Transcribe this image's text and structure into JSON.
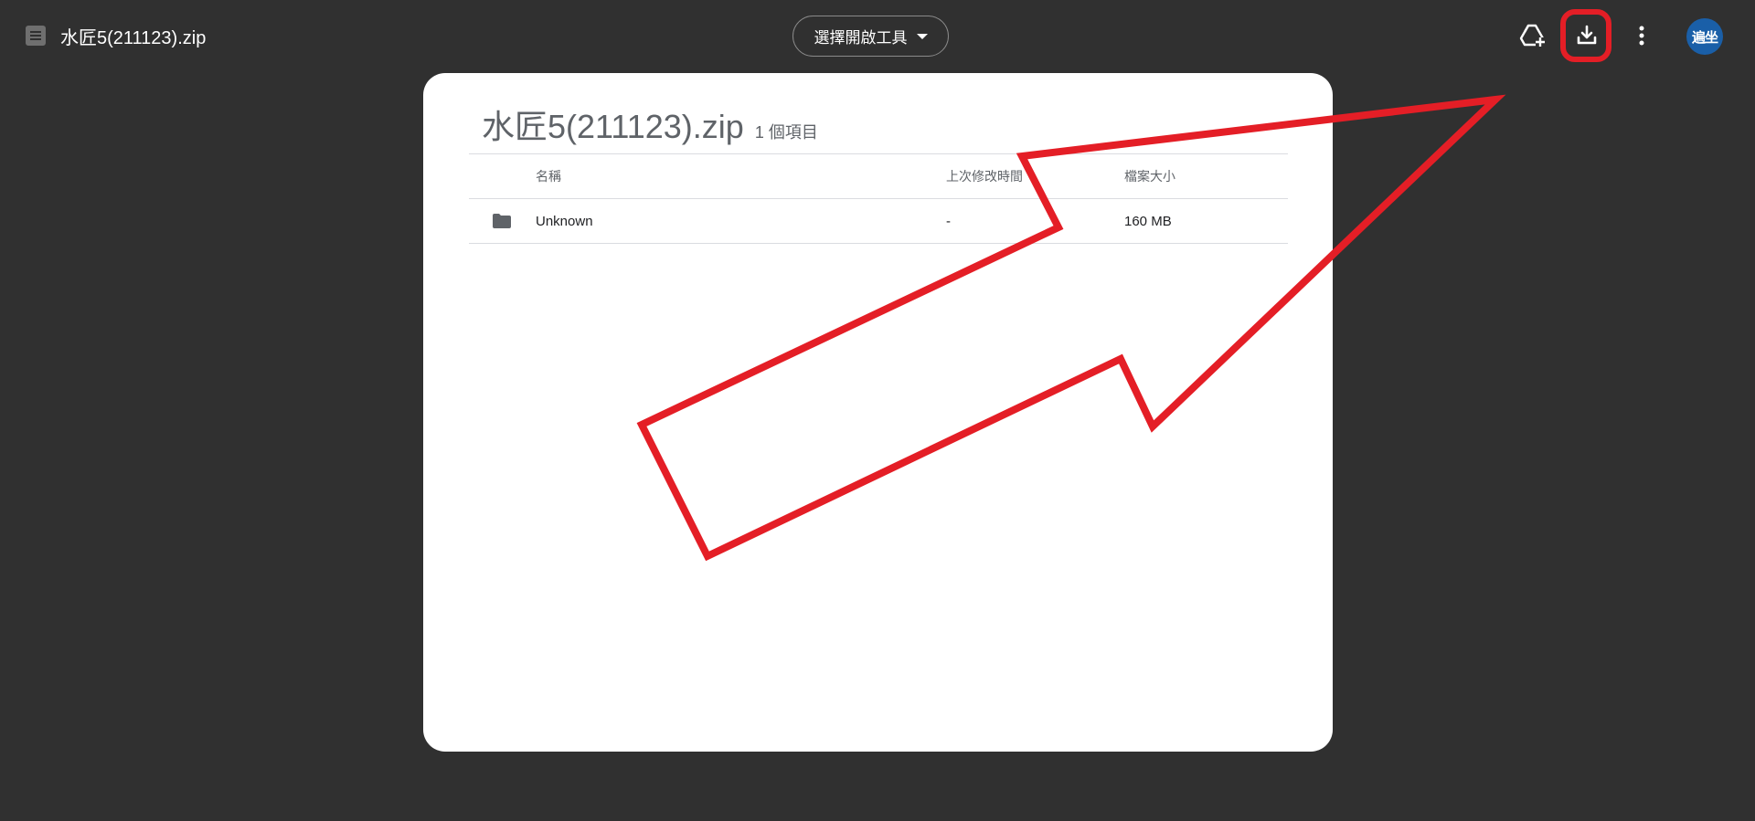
{
  "header": {
    "file_title": "水匠5(211123).zip",
    "open_with_label": "選擇開啟工具",
    "avatar_text": "遍坐",
    "icons": [
      "file-icon",
      "chevron-down-icon",
      "add-to-drive-icon",
      "download-icon",
      "more-vert-icon"
    ]
  },
  "archive": {
    "name": "水匠5(211123).zip",
    "item_count": "1 個項目",
    "columns": {
      "name": "名稱",
      "modified": "上次修改時間",
      "size": "檔案大小"
    },
    "rows": [
      {
        "icon": "folder-icon",
        "name": "Unknown",
        "modified": "-",
        "size": "160 MB"
      }
    ]
  },
  "annotation": {
    "color": "#e41e26",
    "shape": "arrow-pointing-to-download-button"
  },
  "colors": {
    "background": "#303030",
    "card": "#ffffff",
    "avatar": "#1a5fa8",
    "highlight": "#e41e26"
  }
}
